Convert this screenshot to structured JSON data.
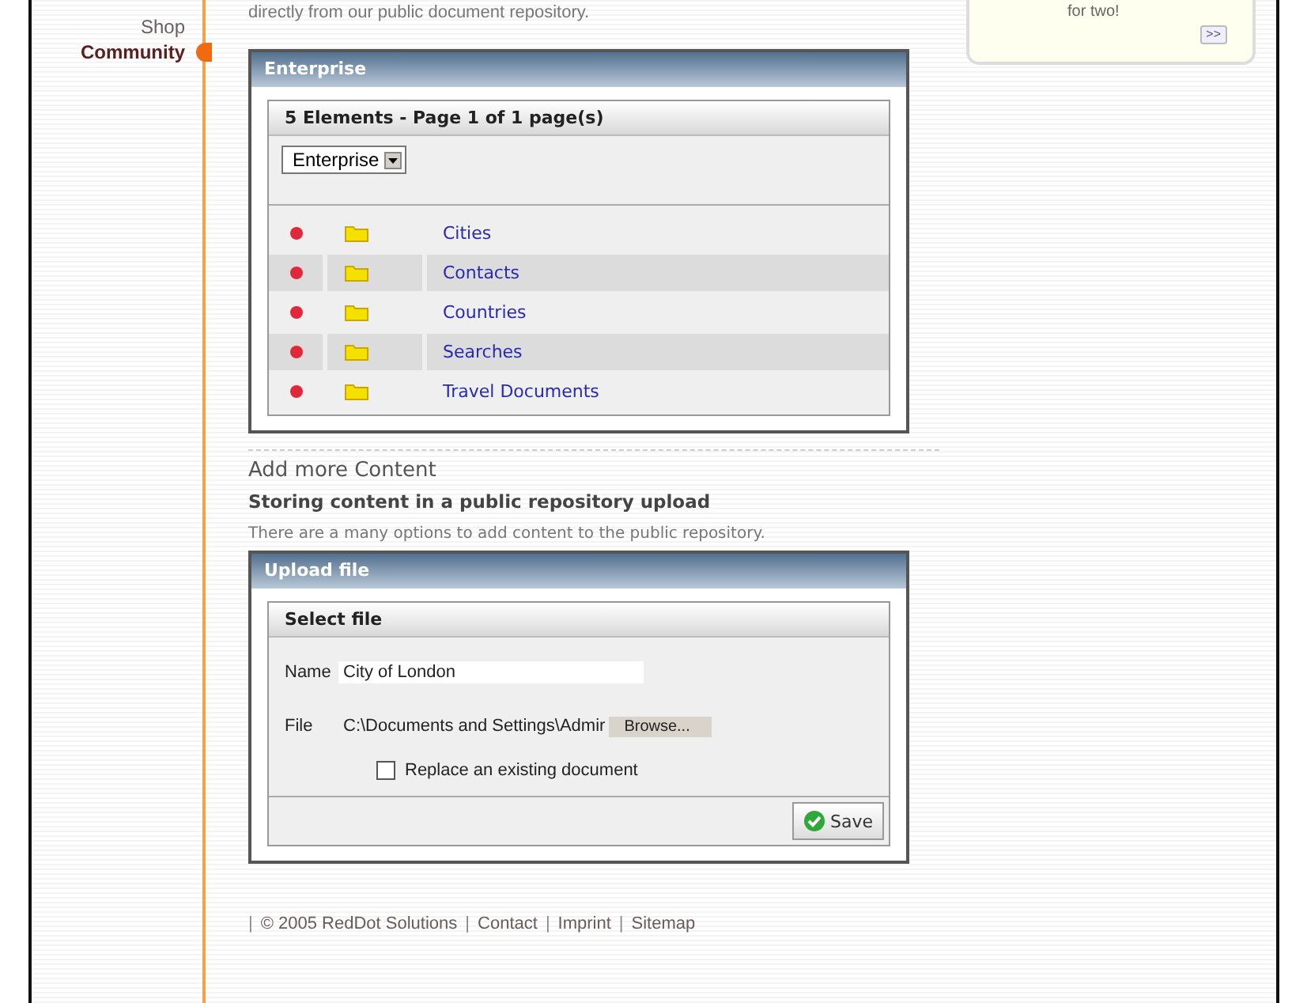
{
  "sidebar": {
    "items": [
      {
        "label": "Shop",
        "selected": false
      },
      {
        "label": "Community",
        "selected": true
      }
    ]
  },
  "intro_text": "directly from our public document repository.",
  "promo": {
    "text": "for two!",
    "more_button": ">>"
  },
  "enterprise_panel": {
    "title": "Enterprise",
    "list_header": "5 Elements - Page 1 of 1 page(s)",
    "filter_select": "Enterprise",
    "items": [
      {
        "label": "Cities"
      },
      {
        "label": "Contacts"
      },
      {
        "label": "Countries"
      },
      {
        "label": "Searches"
      },
      {
        "label": "Travel Documents"
      }
    ]
  },
  "add_content": {
    "heading": "Add more Content",
    "subheading": "Storing content in a public repository upload",
    "description": "There are a many options to add content to the public repository."
  },
  "upload_panel": {
    "title": "Upload file",
    "section_title": "Select file",
    "name_label": "Name",
    "name_value": "City of London",
    "file_label": "File",
    "file_value": "C:\\Documents and Settings\\Admir",
    "browse_button": "Browse...",
    "replace_checkbox": {
      "label": "Replace an existing document",
      "checked": false
    },
    "save_button": "Save"
  },
  "footer": {
    "items": [
      {
        "kind": "separator",
        "text": "|"
      },
      {
        "kind": "text",
        "text": "© 2005 RedDot Solutions"
      },
      {
        "kind": "separator",
        "text": "|"
      },
      {
        "kind": "link",
        "text": "Contact"
      },
      {
        "kind": "separator",
        "text": "|"
      },
      {
        "kind": "link",
        "text": "Imprint"
      },
      {
        "kind": "separator",
        "text": "|"
      },
      {
        "kind": "link",
        "text": "Sitemap"
      }
    ]
  }
}
